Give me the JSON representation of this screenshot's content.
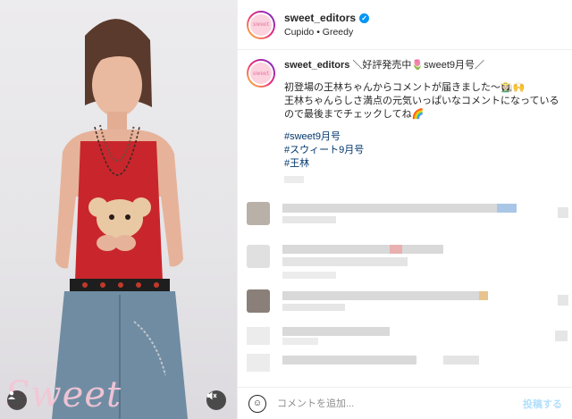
{
  "post": {
    "account": {
      "username": "sweet_editors",
      "avatar_text": "sweet",
      "verified_icon": "verified-badge-icon",
      "audio": "Cupido • Greedy"
    },
    "media": {
      "wordmark": "Sweet",
      "user_tag_icon": "user-icon",
      "mute_icon": "speaker-muted-icon"
    },
    "caption": {
      "username": "sweet_editors",
      "headline": "＼好評発売中🌷sweet9月号／",
      "line1": "初登場の王林ちゃんからコメントが届きました〜👩🏻‍🌾🙌",
      "line2": "王林ちゃんらしさ満点の元気いっぱいなコメントになっている",
      "line3": "ので最後までチェックしてね🌈",
      "hashtags": [
        "#sweet9月号",
        "#スウィート9月号",
        "#王林"
      ]
    },
    "footer": {
      "emoji_icon": "smiley-icon",
      "placeholder": "コメントを追加...",
      "post_label": "投稿する",
      "post_color": "#b2dffc"
    },
    "colors": {
      "link": "#00376b",
      "verified": "#0095f6",
      "wordmark": "#f4c6d6"
    }
  }
}
